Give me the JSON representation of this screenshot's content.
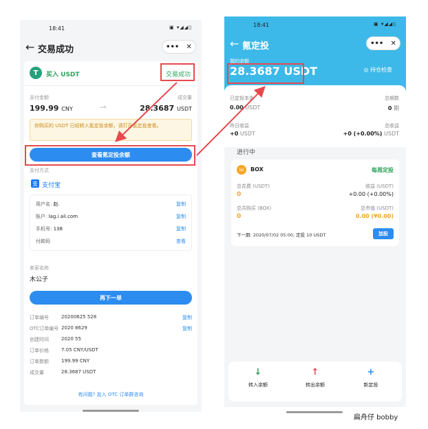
{
  "left": {
    "time": "18:41",
    "title": "交易成功",
    "menu_more": "•••",
    "close": "✕",
    "order": {
      "badge": "T",
      "label": "买入 USDT",
      "status": "交易成功"
    },
    "pay_amount_label": "支付金额",
    "pay_amount": "199.99",
    "pay_currency": "CNY",
    "deal_amount_label": "成交量",
    "deal_amount": "28.3687",
    "deal_currency": "USDT",
    "notice": "你购买的 USDT 已经转入氪定投余额，请打开氪定投查看。",
    "view_button": "查看氪定投余额",
    "pay_method_label": "支付方式",
    "alipay": "支付宝",
    "account_rows": [
      {
        "label": "用户名:",
        "value": "赵.",
        "action": "复制"
      },
      {
        "label": "账户:",
        "value": "lag.i      ail.com",
        "action": "复制"
      },
      {
        "label": "手机号:",
        "value": "138",
        "action": "复制"
      },
      {
        "label": "付款码",
        "value": "",
        "action": "查看"
      }
    ],
    "seller_label": "卖家名称",
    "seller": "木公子",
    "again_button": "再下一单",
    "details": [
      {
        "label": "订单编号",
        "value": "20200625   528",
        "action": "复制"
      },
      {
        "label": "OTC订单编号",
        "value": "2020    8629",
        "action": "复制"
      },
      {
        "label": "创建时间",
        "value": "2020   55",
        "action": ""
      },
      {
        "label": "订单价格",
        "value": "7.05 CNY/USDT",
        "action": ""
      },
      {
        "label": "订单数额",
        "value": "199.99 CNY",
        "action": ""
      },
      {
        "label": "成交量",
        "value": "28.3687 USDT",
        "action": ""
      }
    ],
    "help_link": "有问题? 加入 OTC 订单群咨询"
  },
  "right": {
    "time": "18:41",
    "title": "氪定投",
    "menu_more": "•••",
    "close": "✕",
    "balance_label": "我的余额",
    "balance": "28.3687 USDT",
    "check_label": "持仓检查",
    "invested_label": "已定投本金",
    "invested_value": "0.00",
    "invested_unit": "USDT",
    "periods_label": "总期数",
    "periods_value": "0",
    "periods_unit": "期",
    "yesterday_label": "昨日收益",
    "yesterday_value": "+0",
    "yesterday_unit": "USDT",
    "total_profit_label": "总收益",
    "total_profit_value": "+0 (+0.00%)",
    "total_profit_unit": "USDT",
    "section_title": "进行中",
    "plan": {
      "coin": "BOX",
      "frequency": "每周定投",
      "spent_label": "总花费 (USDT)",
      "spent": "0",
      "profit_label": "收益 (USDT)",
      "profit": "+0.00 (+0.00%)",
      "bought_label": "总共购买 (BOX)",
      "bought": "0",
      "market_label": "总市值 (USDT)",
      "market": "0.00 (¥0.00)",
      "next": "下一期: 2020/07/02 05:00, 定投 10 USDT",
      "add_button": "加投"
    },
    "tabs": [
      {
        "icon": "↓",
        "label": "转入余额",
        "color": "#2aa35a"
      },
      {
        "icon": "↑",
        "label": "转出余额",
        "color": "#e8484d"
      },
      {
        "icon": "+",
        "label": "新定投",
        "color": "#2d8cf0"
      }
    ]
  },
  "watermark": "扁舟仔 bobby",
  "colors": {
    "accent": "#2d8cf0",
    "success": "#2aa35a",
    "annotation": "#e8484d",
    "orange": "#f5a623"
  }
}
